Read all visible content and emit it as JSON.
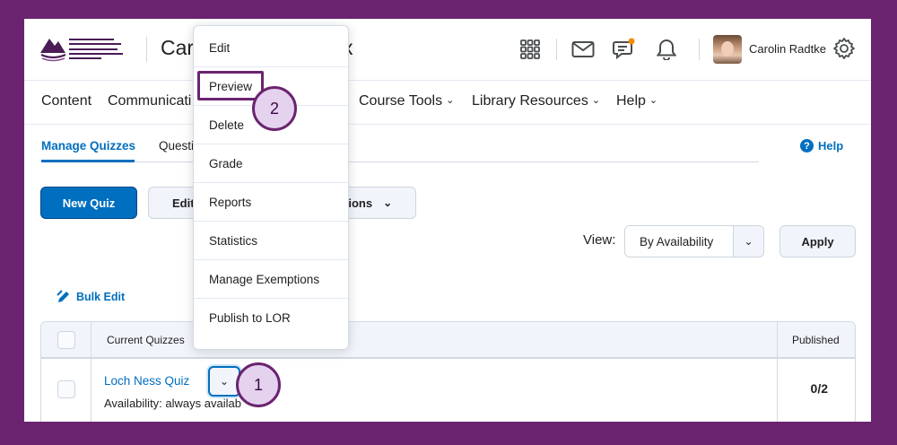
{
  "header": {
    "logo_alt": "University of the Highlands and Islands",
    "course_title_start": "Caro",
    "course_title_end": "x",
    "user_name": "Carolin Radtke",
    "notification_dot_color": "#f28c00"
  },
  "nav": {
    "items": [
      {
        "label": "Content",
        "has_menu": false
      },
      {
        "label": "Communicati",
        "has_menu": false
      },
      {
        "label": "Course Tools",
        "has_menu": true
      },
      {
        "label": "Library Resources",
        "has_menu": true
      },
      {
        "label": "Help",
        "has_menu": true
      }
    ]
  },
  "tabs": {
    "active": "Manage Quizzes",
    "other": "Questi"
  },
  "help_label": "Help",
  "toolbar": {
    "new_quiz": "New Quiz",
    "edit": "Edit",
    "more_actions": "tions"
  },
  "view": {
    "label": "View:",
    "selected": "By Availability",
    "apply": "Apply"
  },
  "bulk_edit": "Bulk Edit",
  "table": {
    "col_current": "Current Quizzes",
    "col_published": "Published",
    "rows": [
      {
        "name": "Loch Ness Quiz",
        "availability": "Availability: always availab",
        "published": "0/2"
      }
    ]
  },
  "menu": {
    "items": [
      "Edit",
      "Preview",
      "Delete",
      "Grade",
      "Reports",
      "Statistics",
      "Manage Exemptions",
      "Publish to LOR"
    ]
  },
  "callouts": [
    "1",
    "2"
  ],
  "colors": {
    "frame": "#6a246f",
    "accent": "#006fbf",
    "callout_fill": "#e4d2ef"
  }
}
